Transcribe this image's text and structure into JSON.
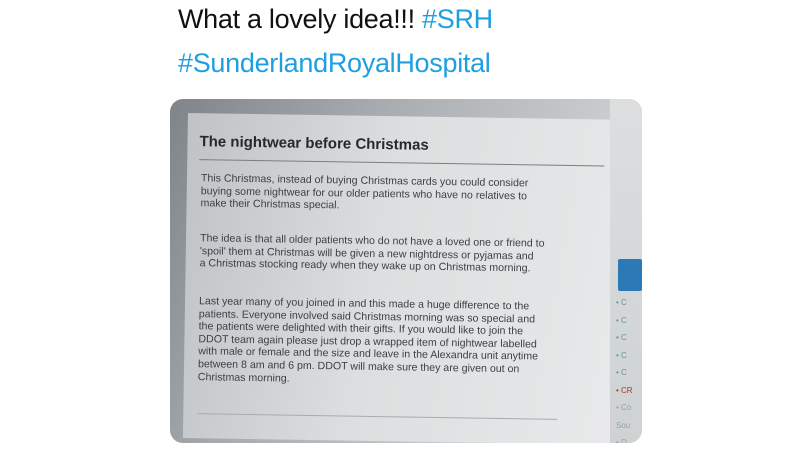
{
  "tweet": {
    "line1_text": "What a lovely idea!!! ",
    "line1_hashtag": "#SRH",
    "line2_hashtag": "#SunderlandRoyalHospital"
  },
  "notice": {
    "title": "The nightwear before Christmas",
    "paragraph1": [
      "This Christmas, instead of buying Christmas cards you could consider",
      "buying some nightwear for our older patients who have no relatives to",
      "make their Christmas special."
    ],
    "paragraph2": [
      "The idea is that all older patients who do not have a loved one or friend to",
      "'spoil' them at Christmas will be given a new nightdress or pyjamas and",
      "a Christmas stocking ready when they wake up on Christmas morning."
    ],
    "paragraph3": [
      "Last year many of you joined in and this made a huge difference to the",
      "patients.  Everyone involved said Christmas morning was so special and",
      "the patients were delighted with their gifts.  If you would like to join the",
      "DDOT team again please just drop a wrapped item of nightwear labelled",
      "with male or female and the size and leave in the Alexandra unit anytime",
      "between 8 am and 6 pm.  DDOT will make sure they are given out on",
      "Christmas morning."
    ]
  },
  "side_panel": {
    "items": [
      "• C",
      "• C",
      "• C",
      "• C",
      "• C",
      "• CR",
      "• Co",
      "Sou",
      "• D"
    ]
  },
  "colors": {
    "hashtag": "#1f9fe0",
    "accent_blue": "#2b79b5",
    "side_link": "#5c9b8a",
    "side_link_red": "#b3342e"
  }
}
